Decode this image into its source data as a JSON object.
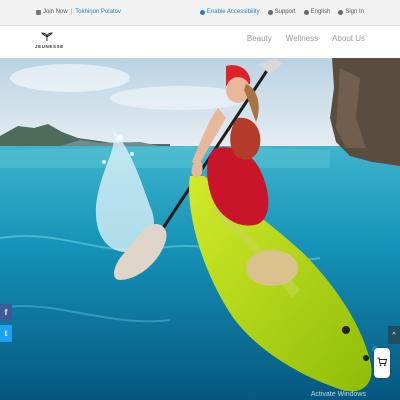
{
  "topbar": {
    "join_now": "Join Now",
    "user_name": "Tokhirjon Polatov",
    "accessibility": "Enable Accessibility",
    "support": "Support",
    "language": "English",
    "sign_in": "Sign In"
  },
  "header": {
    "logo_text": "JEUNESSE",
    "nav": [
      "Beauty",
      "Wellness",
      "About Us"
    ]
  },
  "social": {
    "facebook": "f",
    "twitter": "t"
  },
  "scroll_top": "^",
  "watermark": "Activate Windows",
  "colors": {
    "accent": "#2a7fc4",
    "facebook": "#3a5a98",
    "twitter": "#1da1f2",
    "kayak": "#b6d80e"
  },
  "icons": [
    "user-icon",
    "accessibility-icon",
    "support-icon",
    "globe-icon",
    "sign-in-icon",
    "leaf-logo-icon",
    "cart-icon"
  ]
}
